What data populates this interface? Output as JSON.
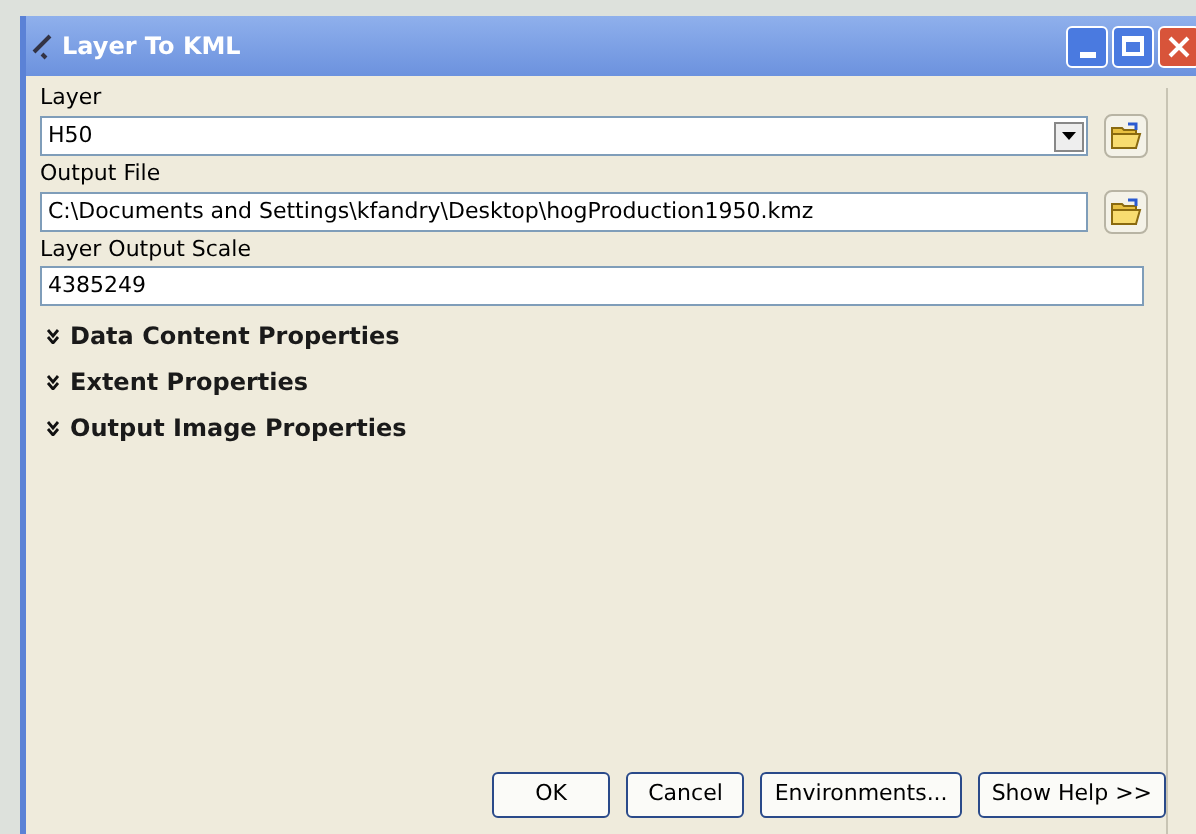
{
  "window": {
    "title": "Layer To KML"
  },
  "fields": [
    {
      "label": "Layer",
      "value": "H50",
      "kind": "dropdown",
      "browse": true
    },
    {
      "label": "Output File",
      "value": "C:\\Documents and Settings\\kfandry\\Desktop\\hogProduction1950.kmz",
      "kind": "text",
      "browse": true
    },
    {
      "label": "Layer Output Scale",
      "value": "4385249",
      "kind": "text",
      "browse": false
    }
  ],
  "sections": [
    {
      "label": "Data Content Properties",
      "expanded": false
    },
    {
      "label": "Extent Properties",
      "expanded": false
    },
    {
      "label": "Output Image Properties",
      "expanded": false
    }
  ],
  "buttons": [
    "OK",
    "Cancel",
    "Environments...",
    "Show Help >>"
  ]
}
